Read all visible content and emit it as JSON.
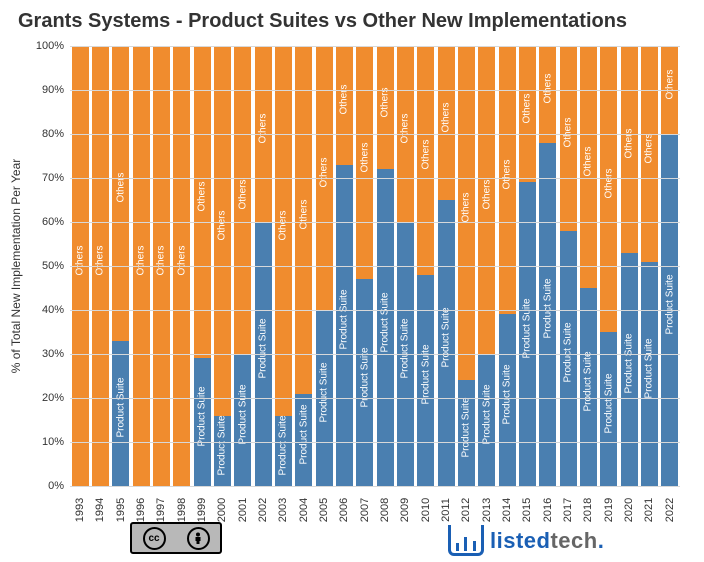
{
  "title": "Grants Systems - Product Suites vs Other New Implementations",
  "ylabel": "% of Total New Implementation Per Year",
  "series_labels": {
    "product_suite": "Product Suite",
    "others": "Others"
  },
  "colors": {
    "product_suite": "#4a7fb0",
    "others": "#f08c2e"
  },
  "yticks": [
    "0%",
    "10%",
    "20%",
    "30%",
    "40%",
    "50%",
    "60%",
    "70%",
    "80%",
    "90%",
    "100%"
  ],
  "brand": {
    "part1": "listed",
    "part2": "tech",
    "dot": "."
  },
  "license": {
    "cc": "cc",
    "by": "BY"
  },
  "chart_data": {
    "type": "bar",
    "stacked": true,
    "xlabel": "",
    "ylabel": "% of Total New Implementation Per Year",
    "ylim": [
      0,
      100
    ],
    "categories": [
      "1993",
      "1994",
      "1995",
      "1996",
      "1997",
      "1998",
      "1999",
      "2000",
      "2001",
      "2002",
      "2003",
      "2004",
      "2005",
      "2006",
      "2007",
      "2008",
      "2009",
      "2010",
      "2011",
      "2012",
      "2013",
      "2014",
      "2015",
      "2016",
      "2017",
      "2018",
      "2019",
      "2020",
      "2021",
      "2022"
    ],
    "series": [
      {
        "name": "Product Suite",
        "values": [
          0,
          0,
          33,
          0,
          0,
          0,
          29,
          16,
          30,
          60,
          16,
          21,
          40,
          73,
          47,
          72,
          60,
          48,
          65,
          24,
          30,
          39,
          69,
          78,
          58,
          45,
          35,
          53,
          51,
          80
        ]
      },
      {
        "name": "Others",
        "values": [
          100,
          100,
          67,
          100,
          100,
          100,
          71,
          84,
          70,
          40,
          84,
          79,
          60,
          27,
          53,
          28,
          40,
          52,
          35,
          76,
          70,
          61,
          31,
          22,
          42,
          55,
          65,
          47,
          49,
          20
        ]
      }
    ],
    "title": "Grants Systems - Product Suites vs Other New Implementations",
    "legend_position": "none"
  }
}
